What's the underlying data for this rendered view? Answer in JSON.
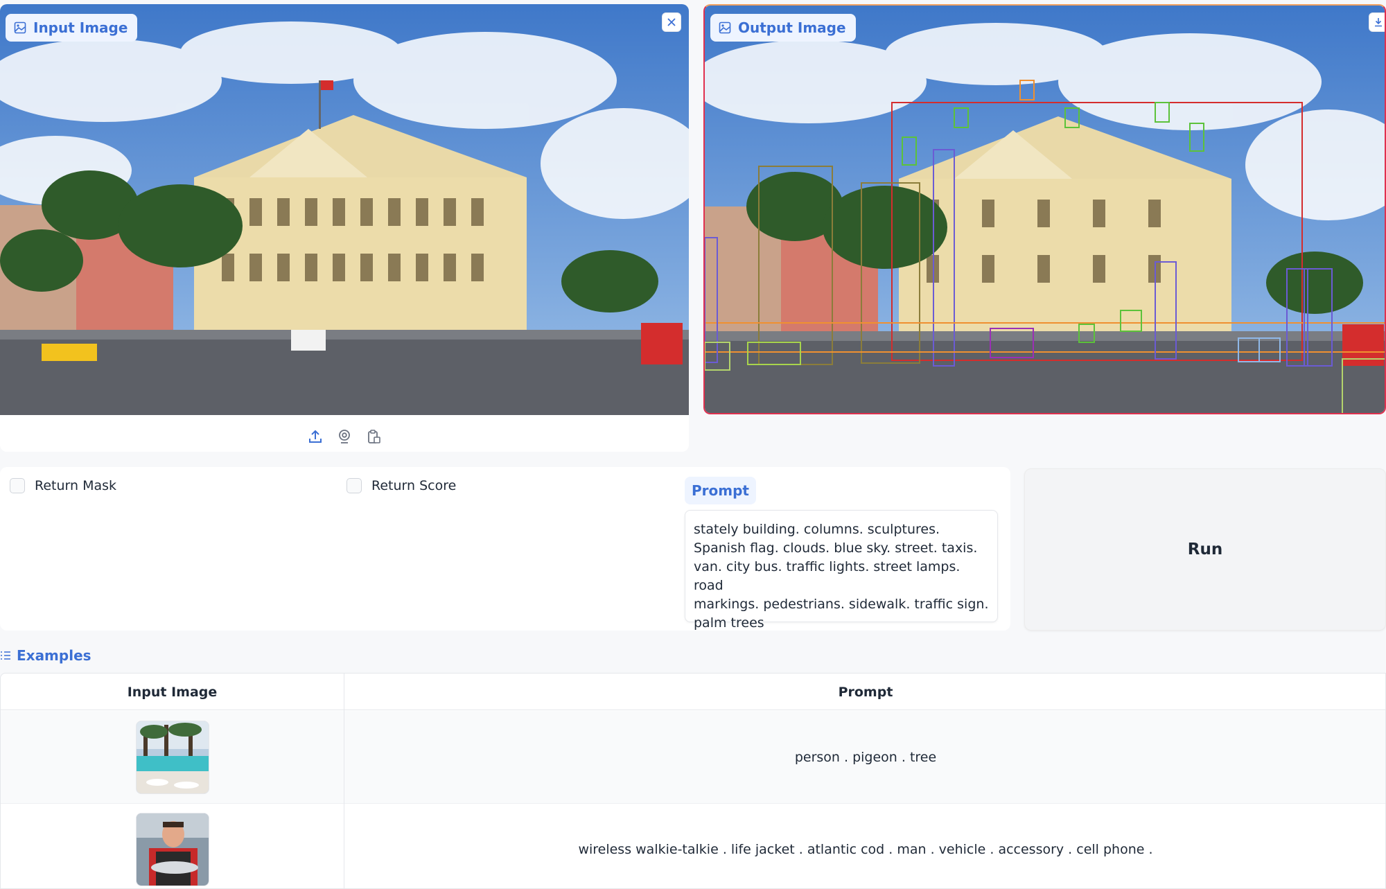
{
  "input_panel": {
    "label": "Input Image",
    "label_icon": "image-icon",
    "close_icon": "close-icon",
    "tools": [
      "upload-icon",
      "webcam-icon",
      "clipboard-icon"
    ]
  },
  "output_panel": {
    "label": "Output Image",
    "label_icon": "image-icon",
    "download_icon": "download-icon"
  },
  "options": {
    "return_mask": {
      "label": "Return Mask",
      "checked": false
    },
    "return_score": {
      "label": "Return Score",
      "checked": false
    }
  },
  "prompt": {
    "label": "Prompt",
    "value": "stately building. columns. sculptures.\nSpanish flag. clouds. blue sky. street. taxis.\nvan. city bus. traffic lights. street lamps. road\nmarkings. pedestrians. sidewalk. traffic sign.\npalm trees"
  },
  "run_button": {
    "label": "Run"
  },
  "examples": {
    "title": "Examples",
    "title_icon": "list-icon",
    "columns": [
      "Input Image",
      "Prompt"
    ],
    "rows": [
      {
        "prompt": "person . pigeon . tree"
      },
      {
        "prompt": "wireless walkie-talkie . life jacket . atlantic cod . man . vehicle . accessory . cell phone ."
      }
    ]
  },
  "colors": {
    "accent": "#3b6fd4",
    "accent_bg": "#eef4ff",
    "output_border": "#e0304e"
  }
}
